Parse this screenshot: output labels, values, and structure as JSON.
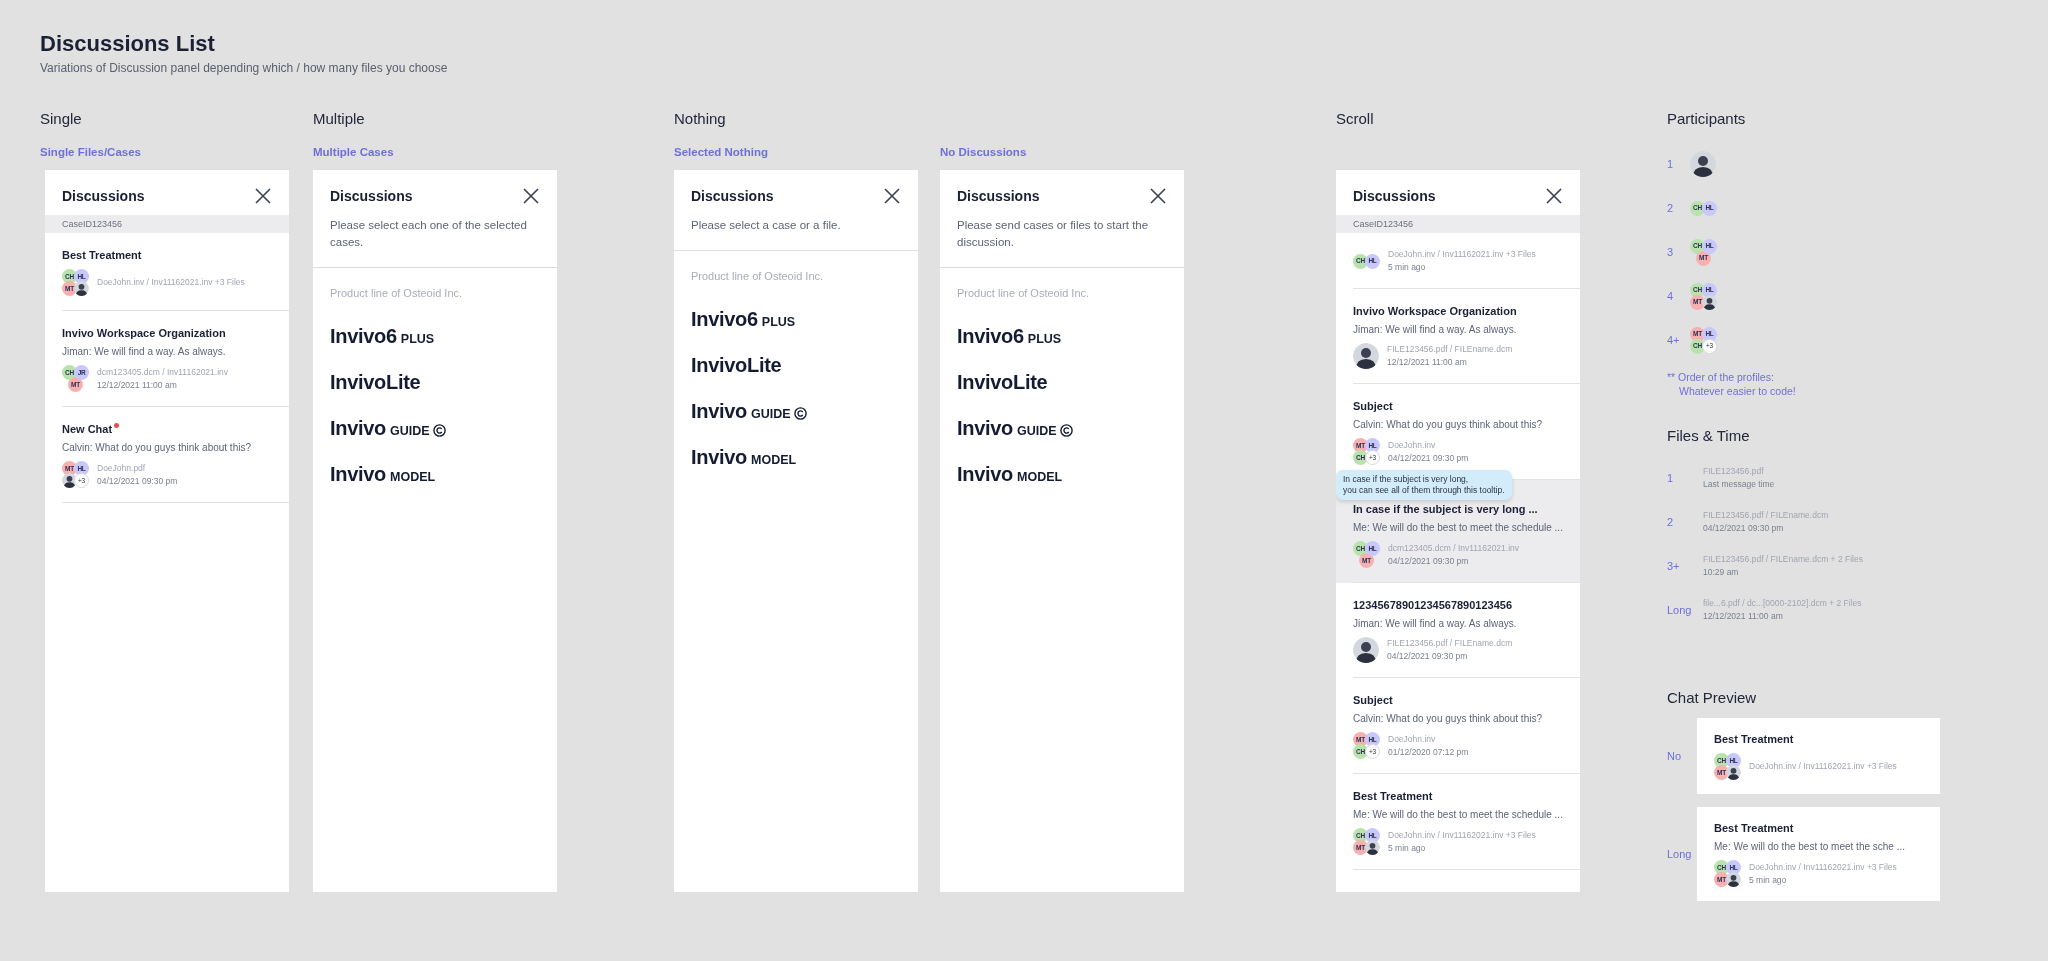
{
  "page": {
    "title": "Discussions List",
    "subtitle": "Variations of Discussion panel depending which / how many files you choose"
  },
  "sections": [
    {
      "heading": "Single",
      "variants": [
        {
          "label": "Single Files/Cases",
          "panel": {
            "title": "Discussions",
            "case_id": "CaseID123456",
            "items": [
              {
                "title": "Best Treatment",
                "unread": false,
                "selected": false,
                "participants": [
                  {
                    "kind": "initials",
                    "text": "CH",
                    "color": "#b9e3ad"
                  },
                  {
                    "kind": "initials",
                    "text": "HL",
                    "color": "#c9c8fb"
                  },
                  {
                    "kind": "initials",
                    "text": "MT",
                    "color": "#f6b0b0"
                  },
                  {
                    "kind": "photo"
                  }
                ],
                "files": "DoeJohn.inv / Inv11162021.inv +3 Files"
              },
              {
                "title": "Invivo Workspace Organization",
                "unread": false,
                "selected": false,
                "message": "Jiman: We will find a way. As always.",
                "participants": [
                  {
                    "kind": "initials",
                    "text": "CH",
                    "color": "#b9e3ad"
                  },
                  {
                    "kind": "initials",
                    "text": "JR",
                    "color": "#c9c8fb"
                  },
                  {
                    "kind": "initials",
                    "text": "MT",
                    "color": "#f6b0b0"
                  }
                ],
                "files": "dcm123405.dcm / Inv11162021.inv",
                "time": "12/12/2021 11:00 am"
              },
              {
                "title": "New Chat",
                "unread": true,
                "selected": false,
                "message": "Calvin: What do you guys think about this?",
                "participants": [
                  {
                    "kind": "initials",
                    "text": "MT",
                    "color": "#f6b0b0"
                  },
                  {
                    "kind": "initials",
                    "text": "HL",
                    "color": "#c9c8fb"
                  },
                  {
                    "kind": "photo"
                  },
                  {
                    "kind": "more",
                    "text": "+3"
                  }
                ],
                "files": "DoeJohn.pdf",
                "time": "04/12/2021 09:30 pm"
              }
            ]
          }
        }
      ]
    },
    {
      "heading": "Multiple",
      "variants": [
        {
          "label": "Multiple Cases",
          "panel": {
            "title": "Discussions",
            "message": "Please select each one of the selected cases.",
            "product_line": {
              "caption": "Product line of Osteoid Inc.",
              "products": [
                {
                  "name": "Invivo6",
                  "suffix": "PLUS"
                },
                {
                  "name": "InvivoLite"
                },
                {
                  "name": "Invivo",
                  "suffix": "GUIDE",
                  "emblem": true
                },
                {
                  "name": "Invivo",
                  "suffix": "MODEL"
                }
              ]
            }
          }
        }
      ]
    },
    {
      "heading": "Nothing",
      "variants": [
        {
          "label": "Selected Nothing",
          "panel": {
            "title": "Discussions",
            "message": "Please select a case or a file.",
            "product_line": {
              "caption": "Product line of Osteoid Inc.",
              "products": [
                {
                  "name": "Invivo6",
                  "suffix": "PLUS"
                },
                {
                  "name": "InvivoLite"
                },
                {
                  "name": "Invivo",
                  "suffix": "GUIDE",
                  "emblem": true
                },
                {
                  "name": "Invivo",
                  "suffix": "MODEL"
                }
              ]
            }
          }
        },
        {
          "label": "No Discussions",
          "panel": {
            "title": "Discussions",
            "message": "Please send cases or files to start the discussion.",
            "product_line": {
              "caption": "Product line of Osteoid Inc.",
              "products": [
                {
                  "name": "Invivo6",
                  "suffix": "PLUS"
                },
                {
                  "name": "InvivoLite"
                },
                {
                  "name": "Invivo",
                  "suffix": "GUIDE",
                  "emblem": true
                },
                {
                  "name": "Invivo",
                  "suffix": "MODEL"
                }
              ]
            }
          }
        }
      ]
    },
    {
      "heading": "Scroll",
      "variants": [
        {
          "panel": {
            "title": "Discussions",
            "case_id": "CaseID123456",
            "items": [
              {
                "unread": false,
                "selected": false,
                "participants": [
                  {
                    "kind": "initials",
                    "text": "CH",
                    "color": "#b9e3ad"
                  },
                  {
                    "kind": "initials",
                    "text": "HL",
                    "color": "#c9c8fb"
                  }
                ],
                "files": "DoeJohn.inv / Inv11162021.inv +3 Files",
                "time": "5 min ago"
              },
              {
                "title": "Invivo Workspace Organization",
                "unread": false,
                "selected": false,
                "message": "Jiman: We will find a way. As always.",
                "participants": [
                  {
                    "kind": "photo"
                  }
                ],
                "files": "FILE123456.pdf / FILEname.dcm",
                "time": "12/12/2021 11:00 am"
              },
              {
                "title": "Subject",
                "unread": false,
                "selected": false,
                "message": "Calvin: What do you guys think about this?",
                "participants": [
                  {
                    "kind": "initials",
                    "text": "MT",
                    "color": "#f6b0b0"
                  },
                  {
                    "kind": "initials",
                    "text": "HL",
                    "color": "#c9c8fb"
                  },
                  {
                    "kind": "initials",
                    "text": "CH",
                    "color": "#b9e3ad"
                  },
                  {
                    "kind": "more",
                    "text": "+3"
                  }
                ],
                "files": "DoeJohn.inv",
                "time": "04/12/2021 09:30 pm"
              },
              {
                "title": "In case if the subject is very long  ...",
                "unread": false,
                "selected": true,
                "tooltip": "In case if the subject is very long,\nyou can see all of them through this tooltip.",
                "message": "Me: We will do the best to meet the schedule ...",
                "participants": [
                  {
                    "kind": "initials",
                    "text": "CH",
                    "color": "#b9e3ad"
                  },
                  {
                    "kind": "initials",
                    "text": "HL",
                    "color": "#c9c8fb"
                  },
                  {
                    "kind": "initials",
                    "text": "MT",
                    "color": "#f6b0b0"
                  }
                ],
                "files": "dcm123405.dcm / Inv11162021.inv",
                "time": "04/12/2021 09:30 pm"
              },
              {
                "title": "12345678901234567890123456",
                "unread": false,
                "selected": false,
                "message": "Jiman: We will find a way. As always.",
                "participants": [
                  {
                    "kind": "photo"
                  }
                ],
                "files": "FILE123456.pdf / FILEname.dcm",
                "time": "04/12/2021 09:30 pm"
              },
              {
                "title": "Subject",
                "unread": false,
                "selected": false,
                "message": "Calvin: What do you guys think about this?",
                "participants": [
                  {
                    "kind": "initials",
                    "text": "MT",
                    "color": "#f6b0b0"
                  },
                  {
                    "kind": "initials",
                    "text": "HL",
                    "color": "#c9c8fb"
                  },
                  {
                    "kind": "initials",
                    "text": "CH",
                    "color": "#b9e3ad"
                  },
                  {
                    "kind": "more",
                    "text": "+3"
                  }
                ],
                "files": "DoeJohn.inv",
                "time": "01/12/2020 07:12 pm"
              },
              {
                "title": "Best Treatment",
                "unread": false,
                "selected": false,
                "message": "Me: We will do the best to meet the schedule ...",
                "participants": [
                  {
                    "kind": "initials",
                    "text": "CH",
                    "color": "#b9e3ad"
                  },
                  {
                    "kind": "initials",
                    "text": "HL",
                    "color": "#c9c8fb"
                  },
                  {
                    "kind": "initials",
                    "text": "MT",
                    "color": "#f6b0b0"
                  },
                  {
                    "kind": "photo"
                  }
                ],
                "files": "DoeJohn.inv / Inv11162021.inv +3 Files",
                "time": "5 min ago"
              }
            ]
          }
        }
      ]
    }
  ],
  "participants": {
    "heading": "Participants",
    "rows": [
      {
        "label": "1",
        "participants": [
          {
            "kind": "photo"
          }
        ]
      },
      {
        "label": "2",
        "participants": [
          {
            "kind": "initials",
            "text": "CH",
            "color": "#b9e3ad"
          },
          {
            "kind": "initials",
            "text": "HL",
            "color": "#c9c8fb"
          }
        ]
      },
      {
        "label": "3",
        "participants": [
          {
            "kind": "initials",
            "text": "CH",
            "color": "#b9e3ad"
          },
          {
            "kind": "initials",
            "text": "HL",
            "color": "#c9c8fb"
          },
          {
            "kind": "initials",
            "text": "MT",
            "color": "#f6b0b0"
          }
        ]
      },
      {
        "label": "4",
        "participants": [
          {
            "kind": "initials",
            "text": "CH",
            "color": "#b9e3ad"
          },
          {
            "kind": "initials",
            "text": "HL",
            "color": "#c9c8fb"
          },
          {
            "kind": "initials",
            "text": "MT",
            "color": "#f6b0b0"
          },
          {
            "kind": "photo"
          }
        ]
      },
      {
        "label": "4+",
        "participants": [
          {
            "kind": "initials",
            "text": "MT",
            "color": "#f6b0b0"
          },
          {
            "kind": "initials",
            "text": "HL",
            "color": "#c9c8fb"
          },
          {
            "kind": "initials",
            "text": "CH",
            "color": "#b9e3ad"
          },
          {
            "kind": "more",
            "text": "+3"
          }
        ]
      }
    ],
    "note": "** Order of the profiles:\nWhatever easier to code!"
  },
  "files_time": {
    "heading": "Files & Time",
    "rows": [
      {
        "label": "1",
        "files": "FILE123456.pdf",
        "time": "Last message time"
      },
      {
        "label": "2",
        "files": "FILE123456.pdf / FILEname.dcm",
        "time": "04/12/2021 09:30 pm"
      },
      {
        "label": "3+",
        "files": "FILE123456.pdf / FILEname.dcm + 2 Files",
        "time": "10:29 am"
      },
      {
        "label": "Long",
        "files": "file...6.pdf / dc...[0000-2102].dcm + 2 Files",
        "time": "12/12/2021 11:00 am"
      }
    ]
  },
  "chat_preview": {
    "heading": "Chat Preview",
    "rows": [
      {
        "label": "No",
        "item": {
          "title": "Best Treatment",
          "participants": [
            {
              "kind": "initials",
              "text": "CH",
              "color": "#b9e3ad"
            },
            {
              "kind": "initials",
              "text": "HL",
              "color": "#c9c8fb"
            },
            {
              "kind": "initials",
              "text": "MT",
              "color": "#f6b0b0"
            },
            {
              "kind": "photo"
            }
          ],
          "files": "DoeJohn.inv / Inv11162021.inv +3 Files"
        }
      },
      {
        "label": "Long",
        "item": {
          "title": "Best Treatment",
          "message": "Me: We will do the best to meet the sche ...",
          "participants": [
            {
              "kind": "initials",
              "text": "CH",
              "color": "#b9e3ad"
            },
            {
              "kind": "initials",
              "text": "HL",
              "color": "#c9c8fb"
            },
            {
              "kind": "initials",
              "text": "MT",
              "color": "#f6b0b0"
            },
            {
              "kind": "photo"
            }
          ],
          "files": "DoeJohn.inv / Inv11162021.inv +3 Files",
          "time": "5 min ago"
        }
      }
    ]
  }
}
